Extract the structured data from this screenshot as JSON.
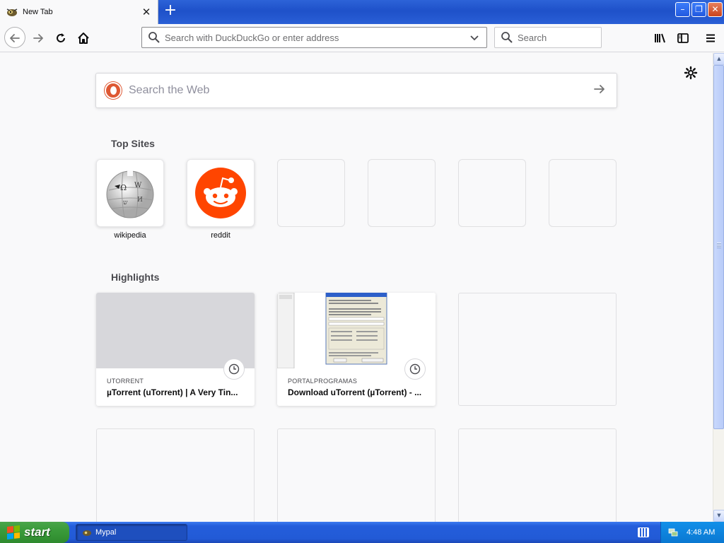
{
  "window": {
    "tab_title": "New Tab",
    "new_tab_symbol": "+",
    "close_tab_symbol": "✕",
    "minimize_symbol": "–",
    "maximize_symbol": "❐",
    "close_symbol": "✕"
  },
  "toolbar": {
    "url_placeholder": "Search with DuckDuckGo or enter address",
    "search_placeholder": "Search"
  },
  "newtab": {
    "web_search_placeholder": "Search the Web",
    "top_sites_title": "Top Sites",
    "top_sites": [
      {
        "label": "wikipedia",
        "icon": "wikipedia-icon"
      },
      {
        "label": "reddit",
        "icon": "reddit-icon"
      },
      {
        "label": "",
        "icon": ""
      },
      {
        "label": "",
        "icon": ""
      },
      {
        "label": "",
        "icon": ""
      },
      {
        "label": "",
        "icon": ""
      }
    ],
    "highlights_title": "Highlights",
    "highlights": [
      {
        "host": "UTORRENT",
        "title": "µTorrent (uTorrent) | A Very Tin..."
      },
      {
        "host": "PORTALPROGRAMAS",
        "title": "Download uTorrent (µTorrent) - ..."
      }
    ]
  },
  "taskbar": {
    "start_label": "start",
    "task_label": "Mypal",
    "clock": "4:48 AM"
  },
  "colors": {
    "accent": "#2a5fd6",
    "reddit": "#ff4500",
    "duckduckgo": "#de5833",
    "start_green": "#3a9b3a"
  }
}
